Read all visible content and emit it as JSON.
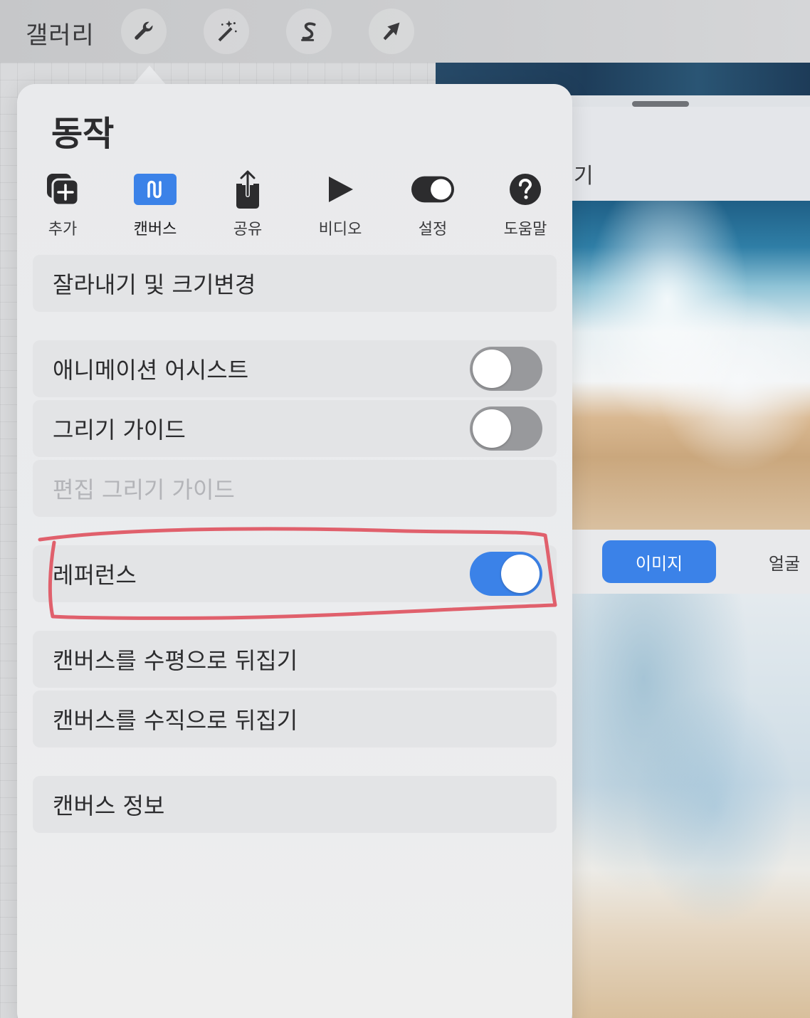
{
  "topbar": {
    "gallery_label": "갤러리",
    "tools": [
      "wrench-icon",
      "magic-wand-icon",
      "s-curve-icon",
      "arrow-icon"
    ]
  },
  "actions": {
    "title": "동작",
    "categories": [
      {
        "label": "추가",
        "icon": "add-layer-icon",
        "active": false
      },
      {
        "label": "캔버스",
        "icon": "canvas-icon",
        "active": true
      },
      {
        "label": "공유",
        "icon": "share-icon",
        "active": false
      },
      {
        "label": "비디오",
        "icon": "play-icon",
        "active": false
      },
      {
        "label": "설정",
        "icon": "toggle-icon",
        "active": false
      },
      {
        "label": "도움말",
        "icon": "help-icon",
        "active": false
      }
    ],
    "items": {
      "crop_resize": "잘라내기 및 크기변경",
      "animation_assist": {
        "label": "애니메이션 어시스트",
        "on": false
      },
      "drawing_guide": {
        "label": "그리기 가이드",
        "on": false
      },
      "edit_drawing_guide": "편집 그리기 가이드",
      "reference": {
        "label": "레퍼런스",
        "on": true
      },
      "flip_horizontal": "캔버스를 수평으로 뒤집기",
      "flip_vertical": "캔버스를 수직으로 뒤집기",
      "canvas_info": "캔버스 정보"
    }
  },
  "reference_panel": {
    "title_fragment": "기",
    "tabs": [
      {
        "label": "이미지",
        "active": true
      },
      {
        "label": "얼굴",
        "active": false
      }
    ]
  },
  "colors": {
    "accent": "#3b82e8",
    "annotation": "#e0606c"
  }
}
